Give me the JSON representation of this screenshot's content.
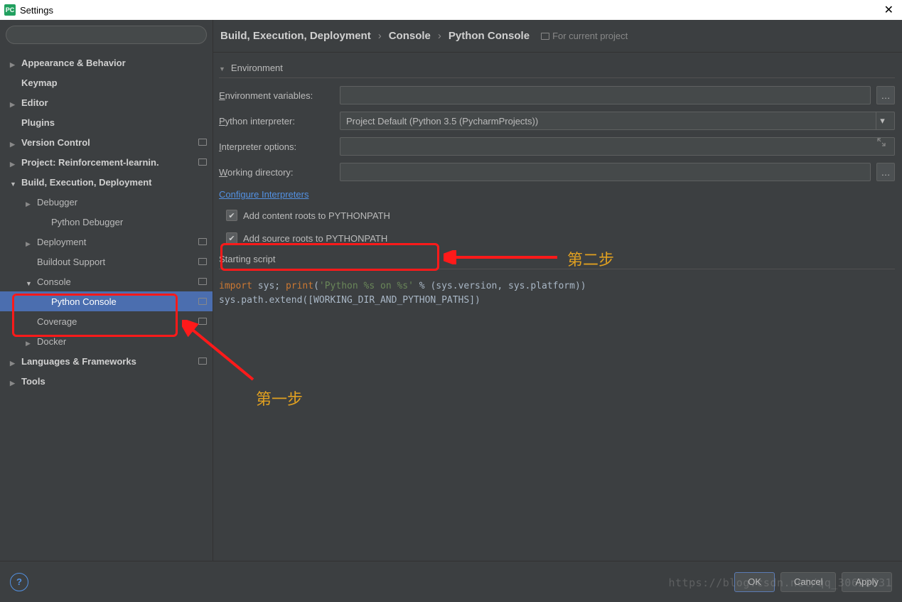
{
  "window": {
    "title": "Settings"
  },
  "tree": {
    "items": [
      {
        "label": "Appearance & Behavior",
        "depth": 0,
        "arrow": "collapse"
      },
      {
        "label": "Keymap",
        "depth": 0,
        "arrow": ""
      },
      {
        "label": "Editor",
        "depth": 0,
        "arrow": "collapse"
      },
      {
        "label": "Plugins",
        "depth": 0,
        "arrow": ""
      },
      {
        "label": "Version Control",
        "depth": 0,
        "arrow": "collapse",
        "right": true
      },
      {
        "label": "Project: Reinforcement-learnin.",
        "depth": 0,
        "arrow": "collapse",
        "right": true
      },
      {
        "label": "Build, Execution, Deployment",
        "depth": 0,
        "arrow": "expand"
      },
      {
        "label": "Debugger",
        "depth": 1,
        "arrow": "collapse"
      },
      {
        "label": "Python Debugger",
        "depth": 2,
        "arrow": ""
      },
      {
        "label": "Deployment",
        "depth": 1,
        "arrow": "collapse",
        "right": true
      },
      {
        "label": "Buildout Support",
        "depth": 1,
        "arrow": "",
        "right": true
      },
      {
        "label": "Console",
        "depth": 1,
        "arrow": "expand",
        "right": true
      },
      {
        "label": "Python Console",
        "depth": 2,
        "arrow": "",
        "right": true,
        "selected": true
      },
      {
        "label": "Coverage",
        "depth": 1,
        "arrow": "",
        "right": true
      },
      {
        "label": "Docker",
        "depth": 1,
        "arrow": "collapse"
      },
      {
        "label": "Languages & Frameworks",
        "depth": 0,
        "arrow": "collapse",
        "right": true
      },
      {
        "label": "Tools",
        "depth": 0,
        "arrow": "collapse"
      }
    ]
  },
  "breadcrumb": {
    "a": "Build, Execution, Deployment",
    "b": "Console",
    "c": "Python Console",
    "badge": "For current project"
  },
  "env": {
    "section": "Environment",
    "envvars": "Environment variables:",
    "interpreter": "Python interpreter:",
    "interpreter_value": "Project Default (Python 3.5 (PycharmProjects))",
    "options": "Interpreter options:",
    "workdir": "Working directory:",
    "configure": "Configure Interpreters",
    "check1": "Add content roots to PYTHONPATH",
    "check2": "Add source roots to PYTHONPATH"
  },
  "starting": {
    "label": "Starting script",
    "line1a": "import",
    "line1b": " sys; ",
    "line1c": "print",
    "line1d": "(",
    "line1e": "'Python %s on %s'",
    "line1f": " % (sys.version, sys.platform))",
    "line2": "sys.path.extend([WORKING_DIR_AND_PYTHON_PATHS])"
  },
  "annotations": {
    "step1": "第一步",
    "step2": "第二步"
  },
  "footer": {
    "ok": "OK",
    "cancel": "Cancel",
    "apply": "Apply"
  },
  "watermark": "https://blog.csdn.net/qq_30622831"
}
